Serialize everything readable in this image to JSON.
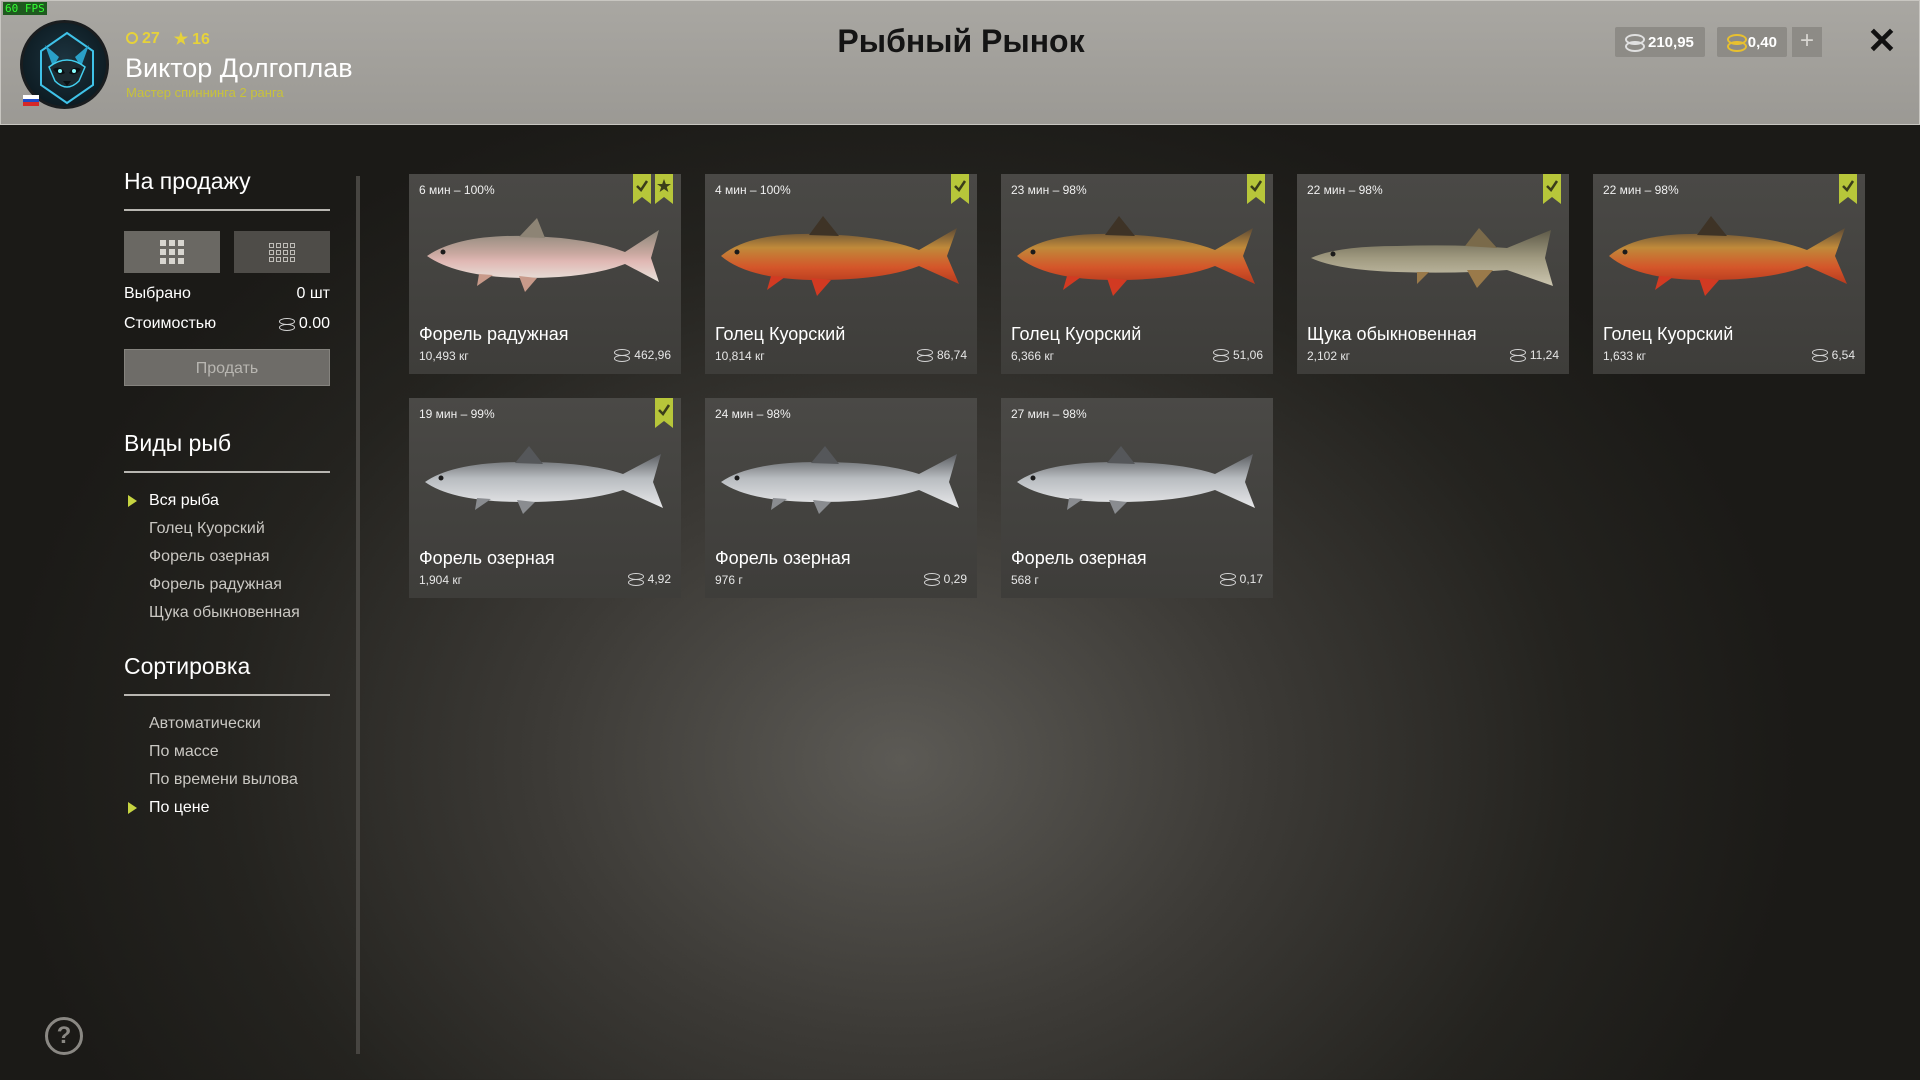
{
  "fps": "60 FPS",
  "player": {
    "level": "27",
    "stars": "16",
    "name": "Виктор Долгоплав",
    "rank": "Мастер спиннинга 2 ранга"
  },
  "title": "Рыбный Рынок",
  "currency": {
    "silver": "210,95",
    "gold": "0,40",
    "add": "+"
  },
  "close_icon": "✕",
  "sale": {
    "title": "На продажу",
    "selected_label": "Выбрано",
    "selected_value": "0 шт",
    "cost_label": "Стоимостью",
    "cost_value": "0.00",
    "sell_button": "Продать"
  },
  "species": {
    "title": "Виды рыб",
    "items": [
      "Вся рыба",
      "Голец Куорский",
      "Форель озерная",
      "Форель радужная",
      "Щука обыкновенная"
    ],
    "active": 0
  },
  "sort": {
    "title": "Сортировка",
    "items": [
      "Автоматически",
      "По массе",
      "По времени вылова",
      "По цене"
    ],
    "active": 3
  },
  "help": "?",
  "colors": {
    "accent": "#c6d441",
    "badge": "#b7c63a"
  },
  "fish": [
    {
      "meta": "6 мин – 100%",
      "name": "Форель радужная",
      "weight": "10,493 кг",
      "price": "462,96",
      "type": "rainbow",
      "check": true,
      "star": true
    },
    {
      "meta": "4 мин – 100%",
      "name": "Голец Куорский",
      "weight": "10,814 кг",
      "price": "86,74",
      "type": "char",
      "check": true,
      "star": false
    },
    {
      "meta": "23 мин – 98%",
      "name": "Голец Куорский",
      "weight": "6,366 кг",
      "price": "51,06",
      "type": "char",
      "check": true,
      "star": false
    },
    {
      "meta": "22 мин – 98%",
      "name": "Щука обыкновенная",
      "weight": "2,102 кг",
      "price": "11,24",
      "type": "pike",
      "check": true,
      "star": false
    },
    {
      "meta": "22 мин – 98%",
      "name": "Голец Куорский",
      "weight": "1,633 кг",
      "price": "6,54",
      "type": "char",
      "check": true,
      "star": false
    },
    {
      "meta": "19 мин – 99%",
      "name": "Форель озерная",
      "weight": "1,904 кг",
      "price": "4,92",
      "type": "laketrout",
      "check": true,
      "star": false
    },
    {
      "meta": "24 мин – 98%",
      "name": "Форель озерная",
      "weight": "976 г",
      "price": "0,29",
      "type": "laketrout",
      "check": false,
      "star": false
    },
    {
      "meta": "27 мин – 98%",
      "name": "Форель озерная",
      "weight": "568 г",
      "price": "0,17",
      "type": "laketrout",
      "check": false,
      "star": false
    }
  ]
}
